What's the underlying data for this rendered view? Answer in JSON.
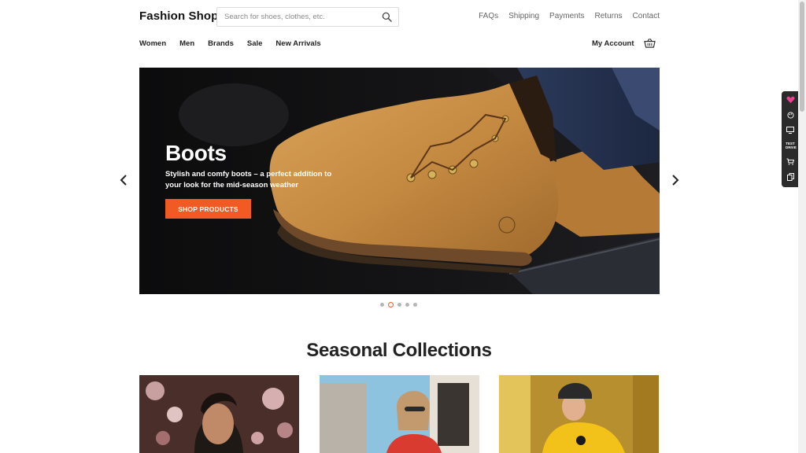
{
  "header": {
    "logo": "Fashion Shop",
    "search_placeholder": "Search for shoes, clothes, etc.",
    "links": [
      "FAQs",
      "Shipping",
      "Payments",
      "Returns",
      "Contact"
    ]
  },
  "nav": {
    "items": [
      "Women",
      "Men",
      "Brands",
      "Sale",
      "New Arrivals"
    ],
    "account": "My Account"
  },
  "hero": {
    "title": "Boots",
    "subtitle": "Stylish and comfy boots – a perfect addition to your look for the mid-season weather",
    "button": "SHOP PRODUCTS",
    "slides": 5,
    "active_slide": 2
  },
  "section": {
    "title": "Seasonal Collections"
  },
  "widget": {
    "test_drive": "TEST DRIVE"
  },
  "colors": {
    "accent": "#f25a24",
    "widget_heart": "#e84393"
  },
  "icons": [
    "search-icon",
    "cart-icon",
    "chevron-left-icon",
    "chevron-right-icon",
    "heart-icon",
    "palette-icon",
    "monitor-icon",
    "cart-icon",
    "copy-icon"
  ]
}
